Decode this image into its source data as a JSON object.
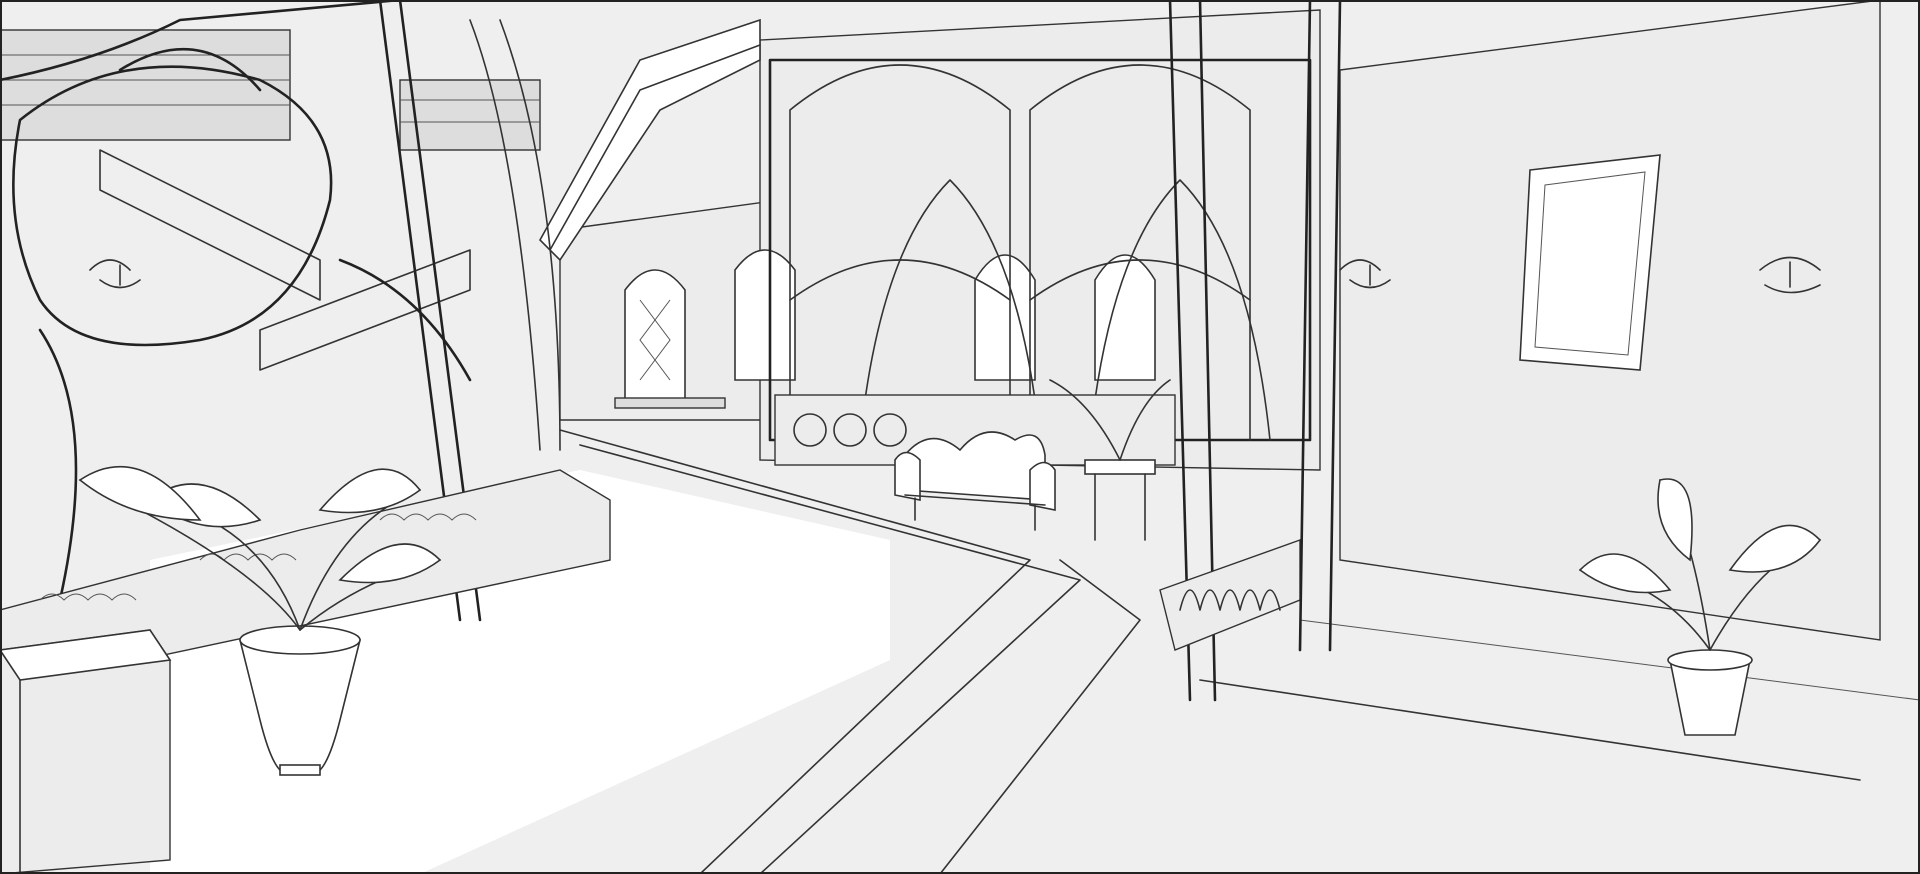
{
  "scene": {
    "style": "monochrome line-art render",
    "colors": {
      "background": "#f4f4f4",
      "line": "#333333",
      "floor_light": "#ffffff",
      "wall": "#ececec"
    },
    "objects": [
      "bookshelves",
      "grand-staircase",
      "arched-door",
      "arched-windows",
      "ornate-screen",
      "sofa",
      "potted-plant",
      "planter-bed",
      "wall-sconce",
      "picture-frame",
      "balustrade",
      "side-table"
    ]
  }
}
